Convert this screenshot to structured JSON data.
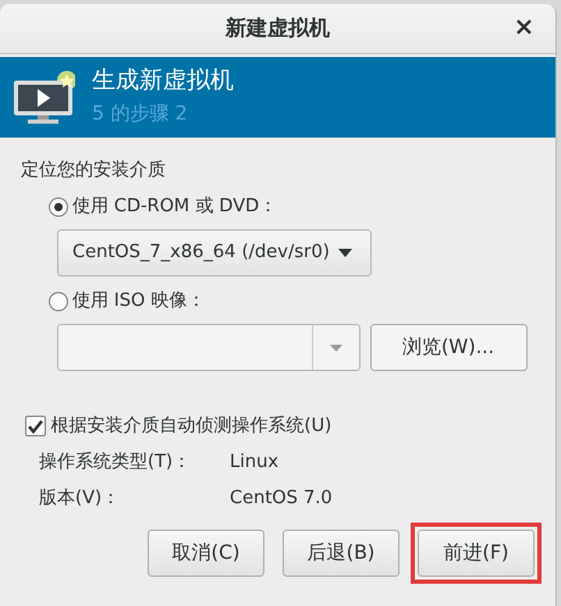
{
  "window": {
    "title": "新建虚拟机",
    "close": "×"
  },
  "header": {
    "title": "生成新虚拟机",
    "step": "5 的步骤 2"
  },
  "section_label": "定位您的安装介质",
  "sources": [
    {
      "kind": "dropdown",
      "label": "使用 CD-ROM 或 DVD：",
      "selected": true,
      "value": "CentOS_7_x86_64 (/dev/sr0)",
      "disabled": false
    },
    {
      "kind": "iso",
      "label": "使用 ISO 映像：",
      "selected": false,
      "browse": "浏览(W)...",
      "disabled": true
    }
  ],
  "autodetect": {
    "label": "根据安装介质自动侦测操作系统(U)",
    "checked": true
  },
  "os_info": [
    {
      "label": "操作系统类型(T)：",
      "value": "Linux"
    },
    {
      "label": "版本(V)：",
      "value": "CentOS 7.0"
    }
  ],
  "buttons": [
    {
      "label": "取消(C)",
      "highlighted": false
    },
    {
      "label": "后退(B)",
      "highlighted": false
    },
    {
      "label": "前进(F)",
      "highlighted": true
    }
  ]
}
